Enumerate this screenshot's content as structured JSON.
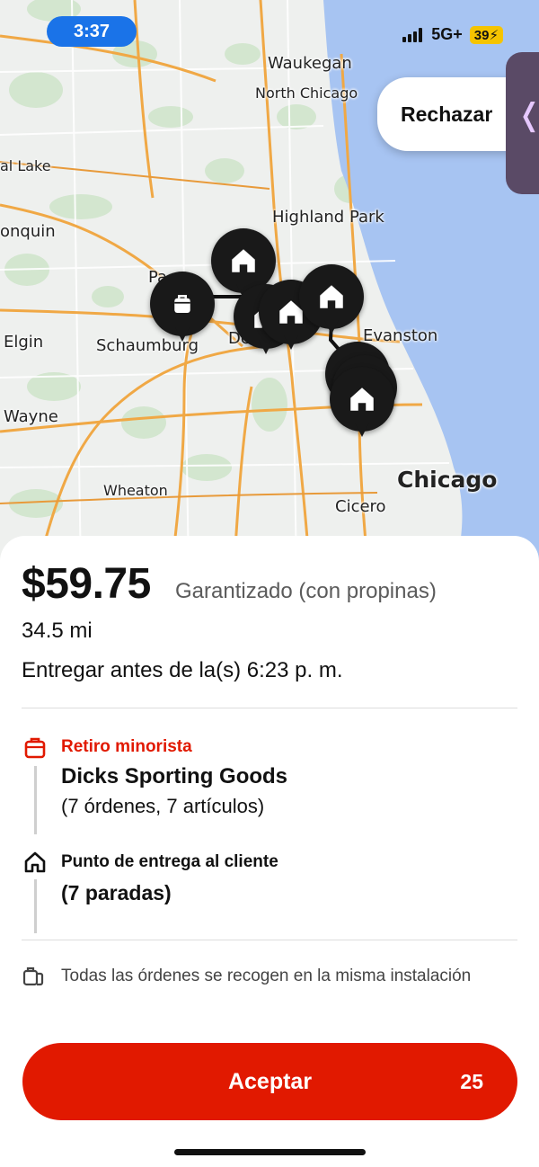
{
  "status_bar": {
    "time": "3:37",
    "network": "5G+",
    "battery": "39"
  },
  "map": {
    "places": [
      {
        "id": "waukegan",
        "name": "Waukegan"
      },
      {
        "id": "north-chicago",
        "name": "North Chicago"
      },
      {
        "id": "lake",
        "name": "al Lake"
      },
      {
        "id": "highland-park",
        "name": "Highland Park"
      },
      {
        "id": "algonquin",
        "name": "onquin"
      },
      {
        "id": "palatine",
        "name": "Pa"
      },
      {
        "id": "elgin",
        "name": "Elgin"
      },
      {
        "id": "schaumburg",
        "name": "Schaumburg"
      },
      {
        "id": "des-plaines",
        "name": "De"
      },
      {
        "id": "evanston",
        "name": "Evanston"
      },
      {
        "id": "wayne",
        "name": "Wayne"
      },
      {
        "id": "wheaton",
        "name": "Wheaton"
      },
      {
        "id": "chicago",
        "name": "Chicago"
      },
      {
        "id": "cicero",
        "name": "Cicero"
      }
    ],
    "reject_label": "Rechazar",
    "side_tab_glyph": "❬",
    "pins": [
      {
        "type": "bag-icon"
      },
      {
        "type": "home-icon"
      },
      {
        "type": "home-icon"
      },
      {
        "type": "home-icon"
      },
      {
        "type": "home-icon"
      },
      {
        "type": "home-icon"
      },
      {
        "type": "home-icon"
      },
      {
        "type": "home-icon"
      }
    ]
  },
  "offer": {
    "price": "$59.75",
    "guarantee": "Garantizado (con propinas)",
    "distance": "34.5 mi",
    "deliver_by": "Entregar antes de la(s) 6:23 p. m."
  },
  "pickup": {
    "label": "Retiro minorista",
    "store": "Dicks Sporting Goods",
    "orders": "(7 órdenes, 7 artículos)"
  },
  "dropoff": {
    "label": "Punto de entrega al cliente",
    "stops": "(7 paradas)"
  },
  "note": "Todas las órdenes se recogen en la misma instalación",
  "accept": {
    "label": "Aceptar",
    "countdown": "25"
  },
  "colors": {
    "accent": "#e11900",
    "water": "#a7c4f2",
    "status_blue": "#1a73e8",
    "pin": "#191919"
  }
}
